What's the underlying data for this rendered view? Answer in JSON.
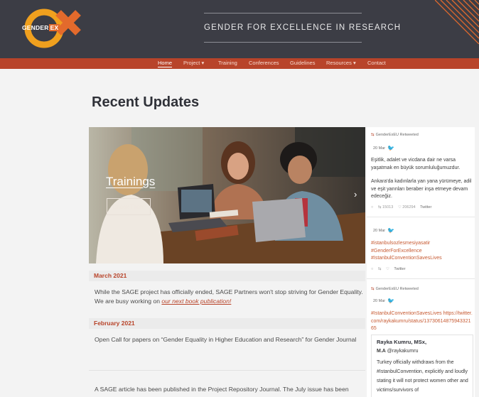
{
  "header": {
    "logo_text": "GENDER",
    "logo_suffix": "EX",
    "site_title": "GENDER FOR EXCELLENCE IN RESEARCH"
  },
  "nav": {
    "items": [
      {
        "label": "Home",
        "active": true
      },
      {
        "label": "Project",
        "dropdown": "▾"
      },
      {
        "label": "Training"
      },
      {
        "label": "Conferences"
      },
      {
        "label": "Guidelines"
      },
      {
        "label": "Resources",
        "dropdown": "▾"
      },
      {
        "label": "Contact"
      }
    ]
  },
  "main": {
    "heading": "Recent Updates",
    "hero": {
      "label": "Trainings",
      "button": "Check Them",
      "next_arrow": "›"
    },
    "sections": [
      {
        "date": "March 2021",
        "text": "While the SAGE project has officially ended, SAGE Partners won't stop striving for Gender Equality. We are busy working on ",
        "link": "our next book publication!"
      },
      {
        "date": "February 2021",
        "text": "Open Call for papers on “Gender Equality in Higher Education and Research” for Gender Journal"
      }
    ],
    "last_text": "A SAGE article has been published in the Project Repository Journal. The July issue has been"
  },
  "twitter": {
    "tweets": [
      {
        "retweet": "GenderExEU Retweeted",
        "date": "20 Mar",
        "text": "Eşitlik, adalet ve vicdana dair ne varsa yaşatmak en büyük sorumluluğumuzdur.",
        "text2": "Ankara'da kadınlarla yan yana yürümeye, adil ve eşit yarınları beraber inşa etmeye devam edeceğiz.",
        "retweets": "15013",
        "likes": "206294",
        "source": "Twitter"
      },
      {
        "date": "20 Mar",
        "text": "#istanbulsozlesmesiyasatir #GenderForExcellence #IstanbulConventionSavesLives",
        "source": "Twitter"
      },
      {
        "retweet": "GenderExEU Retweeted",
        "date": "20 Mar",
        "text": "#IstanbulConventionSavesLives https://twitter.com/raykakumru/status/1373061487594332165",
        "quote_name": "Rayka Kumru, MSx,",
        "quote_handle_bold": "M.A",
        "quote_handle": " @raykakumru",
        "quote_text": "Turkey officially withdraws from the #IstanbulConvention, explicitly and loudly stating it will not protect women other and victims/survivors of"
      }
    ]
  },
  "colors": {
    "header_bg": "#3c3d45",
    "nav_bg": "#b8442a",
    "accent": "#e36a2c",
    "page_bg": "#f3f3f3"
  }
}
